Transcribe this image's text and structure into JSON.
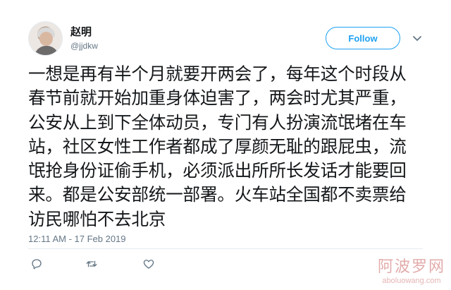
{
  "tweet": {
    "author": {
      "display_name": "赵明",
      "handle": "@jjdkw"
    },
    "follow_label": "Follow",
    "text": "一想是再有半个月就要开两会了，每年这个时段从春节前就开始加重身体迫害了，两会时尤其严重，公安从上到下全体动员，专门有人扮演流氓堵在车站，社区女性工作者都成了厚颜无耻的跟屁虫，流氓抢身份证偷手机，必须派出所所长发话才能要回来。都是公安部统一部署。火车站全国都不卖票给访民哪怕不去北京",
    "timestamp": "12:11 AM - 17 Feb 2019",
    "actions": {
      "reply_icon": "reply-icon",
      "retweet_icon": "retweet-icon",
      "like_icon": "heart-icon"
    }
  },
  "watermark": {
    "title": "阿波罗网",
    "url": "aboluowang.com"
  },
  "colors": {
    "accent": "#1da1f2",
    "text": "#14171a",
    "secondary": "#657786",
    "divider": "#e6ecf0"
  }
}
